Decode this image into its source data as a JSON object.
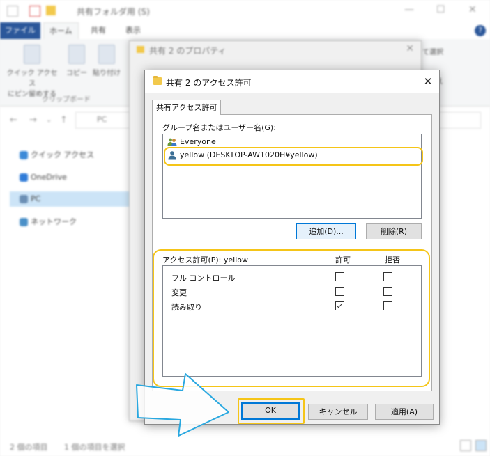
{
  "explorer": {
    "title": "共有フォルダ用 (S)",
    "tabs": [
      "ファイル",
      "ホーム",
      "共有",
      "表示"
    ],
    "ribbon_buttons": [
      "クイック アクセス\nにピン留めする",
      "コピー",
      "貼り付け"
    ],
    "ribbon_group": "クリップボード",
    "ribbon_right": [
      "て選択",
      "り替え"
    ],
    "address": "PC",
    "nav": [
      "クイック アクセス",
      "OneDrive",
      "PC",
      "ネットワーク"
    ],
    "status_items": "2 個の項目",
    "status_selected": "1 個の項目を選択"
  },
  "properties": {
    "title": "共有 2 のプロパティ"
  },
  "dialog": {
    "title": "共有 2 のアクセス許可",
    "tab": "共有アクセス許可",
    "group_label": "グループ名またはユーザー名(G):",
    "users": [
      {
        "name": "Everyone",
        "icon": "group-icon"
      },
      {
        "name": "yellow (DESKTOP-AW1020H¥yellow)",
        "icon": "user-icon"
      }
    ],
    "add_button": "追加(D)...",
    "remove_button": "削除(R)",
    "perm_label": "アクセス許可(P): yellow",
    "col_allow": "許可",
    "col_deny": "拒否",
    "permissions": [
      {
        "name": "フル コントロール",
        "allow": false,
        "deny": false
      },
      {
        "name": "変更",
        "allow": false,
        "deny": false
      },
      {
        "name": "読み取り",
        "allow": true,
        "deny": false
      }
    ],
    "ok": "OK",
    "cancel": "キャンセル",
    "apply": "適用(A)"
  },
  "colors": {
    "highlight": "#f5c518",
    "arrow": "#29a8e0",
    "accent": "#0078d7"
  }
}
